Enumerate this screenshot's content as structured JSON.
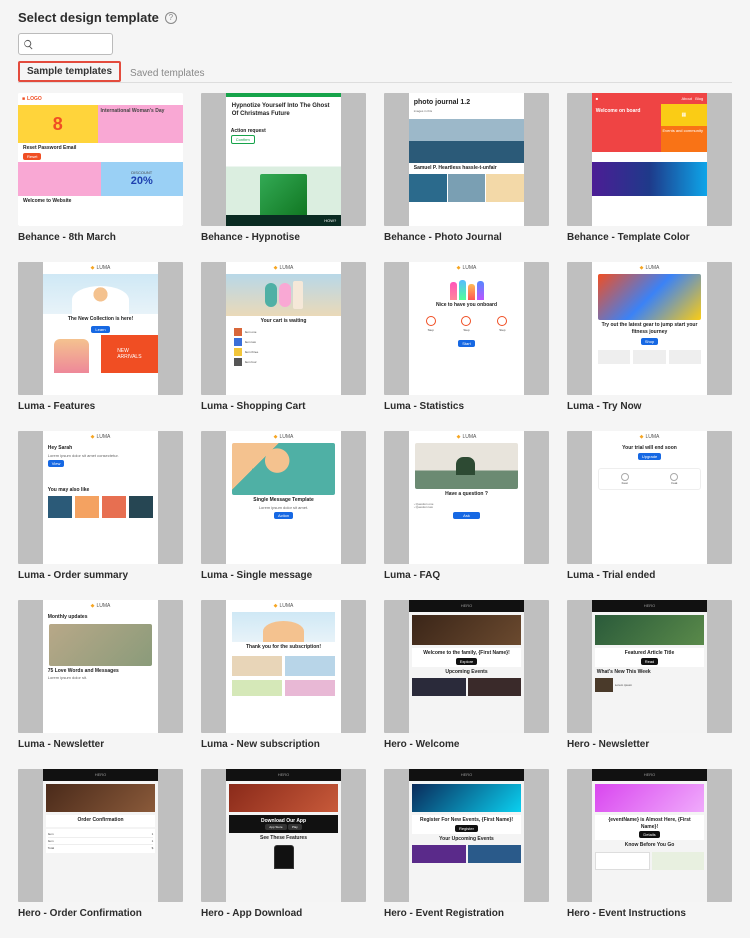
{
  "header": {
    "title": "Select design template"
  },
  "search": {
    "placeholder": ""
  },
  "tabs": {
    "sample": "Sample templates",
    "saved": "Saved templates"
  },
  "templates": [
    {
      "label": "Behance - 8th March"
    },
    {
      "label": "Behance - Hypnotise"
    },
    {
      "label": "Behance - Photo Journal"
    },
    {
      "label": "Behance - Template Color"
    },
    {
      "label": "Luma - Features"
    },
    {
      "label": "Luma - Shopping Cart"
    },
    {
      "label": "Luma - Statistics"
    },
    {
      "label": "Luma - Try Now"
    },
    {
      "label": "Luma - Order summary"
    },
    {
      "label": "Luma - Single message"
    },
    {
      "label": "Luma - FAQ"
    },
    {
      "label": "Luma - Trial ended"
    },
    {
      "label": "Luma - Newsletter"
    },
    {
      "label": "Luma - New subscription"
    },
    {
      "label": "Hero - Welcome"
    },
    {
      "label": "Hero - Newsletter"
    },
    {
      "label": "Hero - Order Confirmation"
    },
    {
      "label": "Hero - App Download"
    },
    {
      "label": "Hero - Event Registration"
    },
    {
      "label": "Hero - Event Instructions"
    }
  ],
  "thumb_text": {
    "behance_logo": "LOGO",
    "womens_day": "International Woman's Day",
    "reset_pwd": "Reset Password Email",
    "discount": "DISCOUNT",
    "twenty": "20%",
    "welcome_site": "Welcome to Website",
    "hypnotise_title": "Hypnotize Yourself Into The Ghost Of Christmas Future",
    "action_req": "Action request",
    "how": "HOW?",
    "photo_journal": "photo journal 1.2",
    "photo_sub": "Samuel P. Heartless hassle-t-unfair",
    "welcome_learn": "Welcome on board",
    "events_community": "Events and community",
    "collection": "The New Collection is here!",
    "cart_waiting": "Your cart is waiting",
    "onboard": "Nice to have you onboard",
    "try_gear": "Try out the latest gear to jump start your fitness journey",
    "hey_sarah": "Hey Sarah",
    "may_like": "You may also like",
    "single_msg": "Single Message Template",
    "have_question": "Have a question ?",
    "trial_end": "Your trial will end soon",
    "monthly": "Monthly updates",
    "love_words": "75 Love Words and Messages",
    "thanks_sub": "Thank you for the subscription!",
    "welcome_family": "Welcome to the family, {First Name}!",
    "upcoming": "Upcoming Events",
    "featured_article": "Featured Article Title",
    "whats_new": "What's New This Week",
    "order_conf": "Order Confirmation",
    "download_app": "Download Our App",
    "see_features": "See These Features",
    "register_event": "Register For New Events, {First Name}!",
    "your_upcoming": "Your Upcoming Events",
    "almost_here": "{eventName} is Almost Here, {First Name}!",
    "before_you_go": "Know Before You Go"
  }
}
